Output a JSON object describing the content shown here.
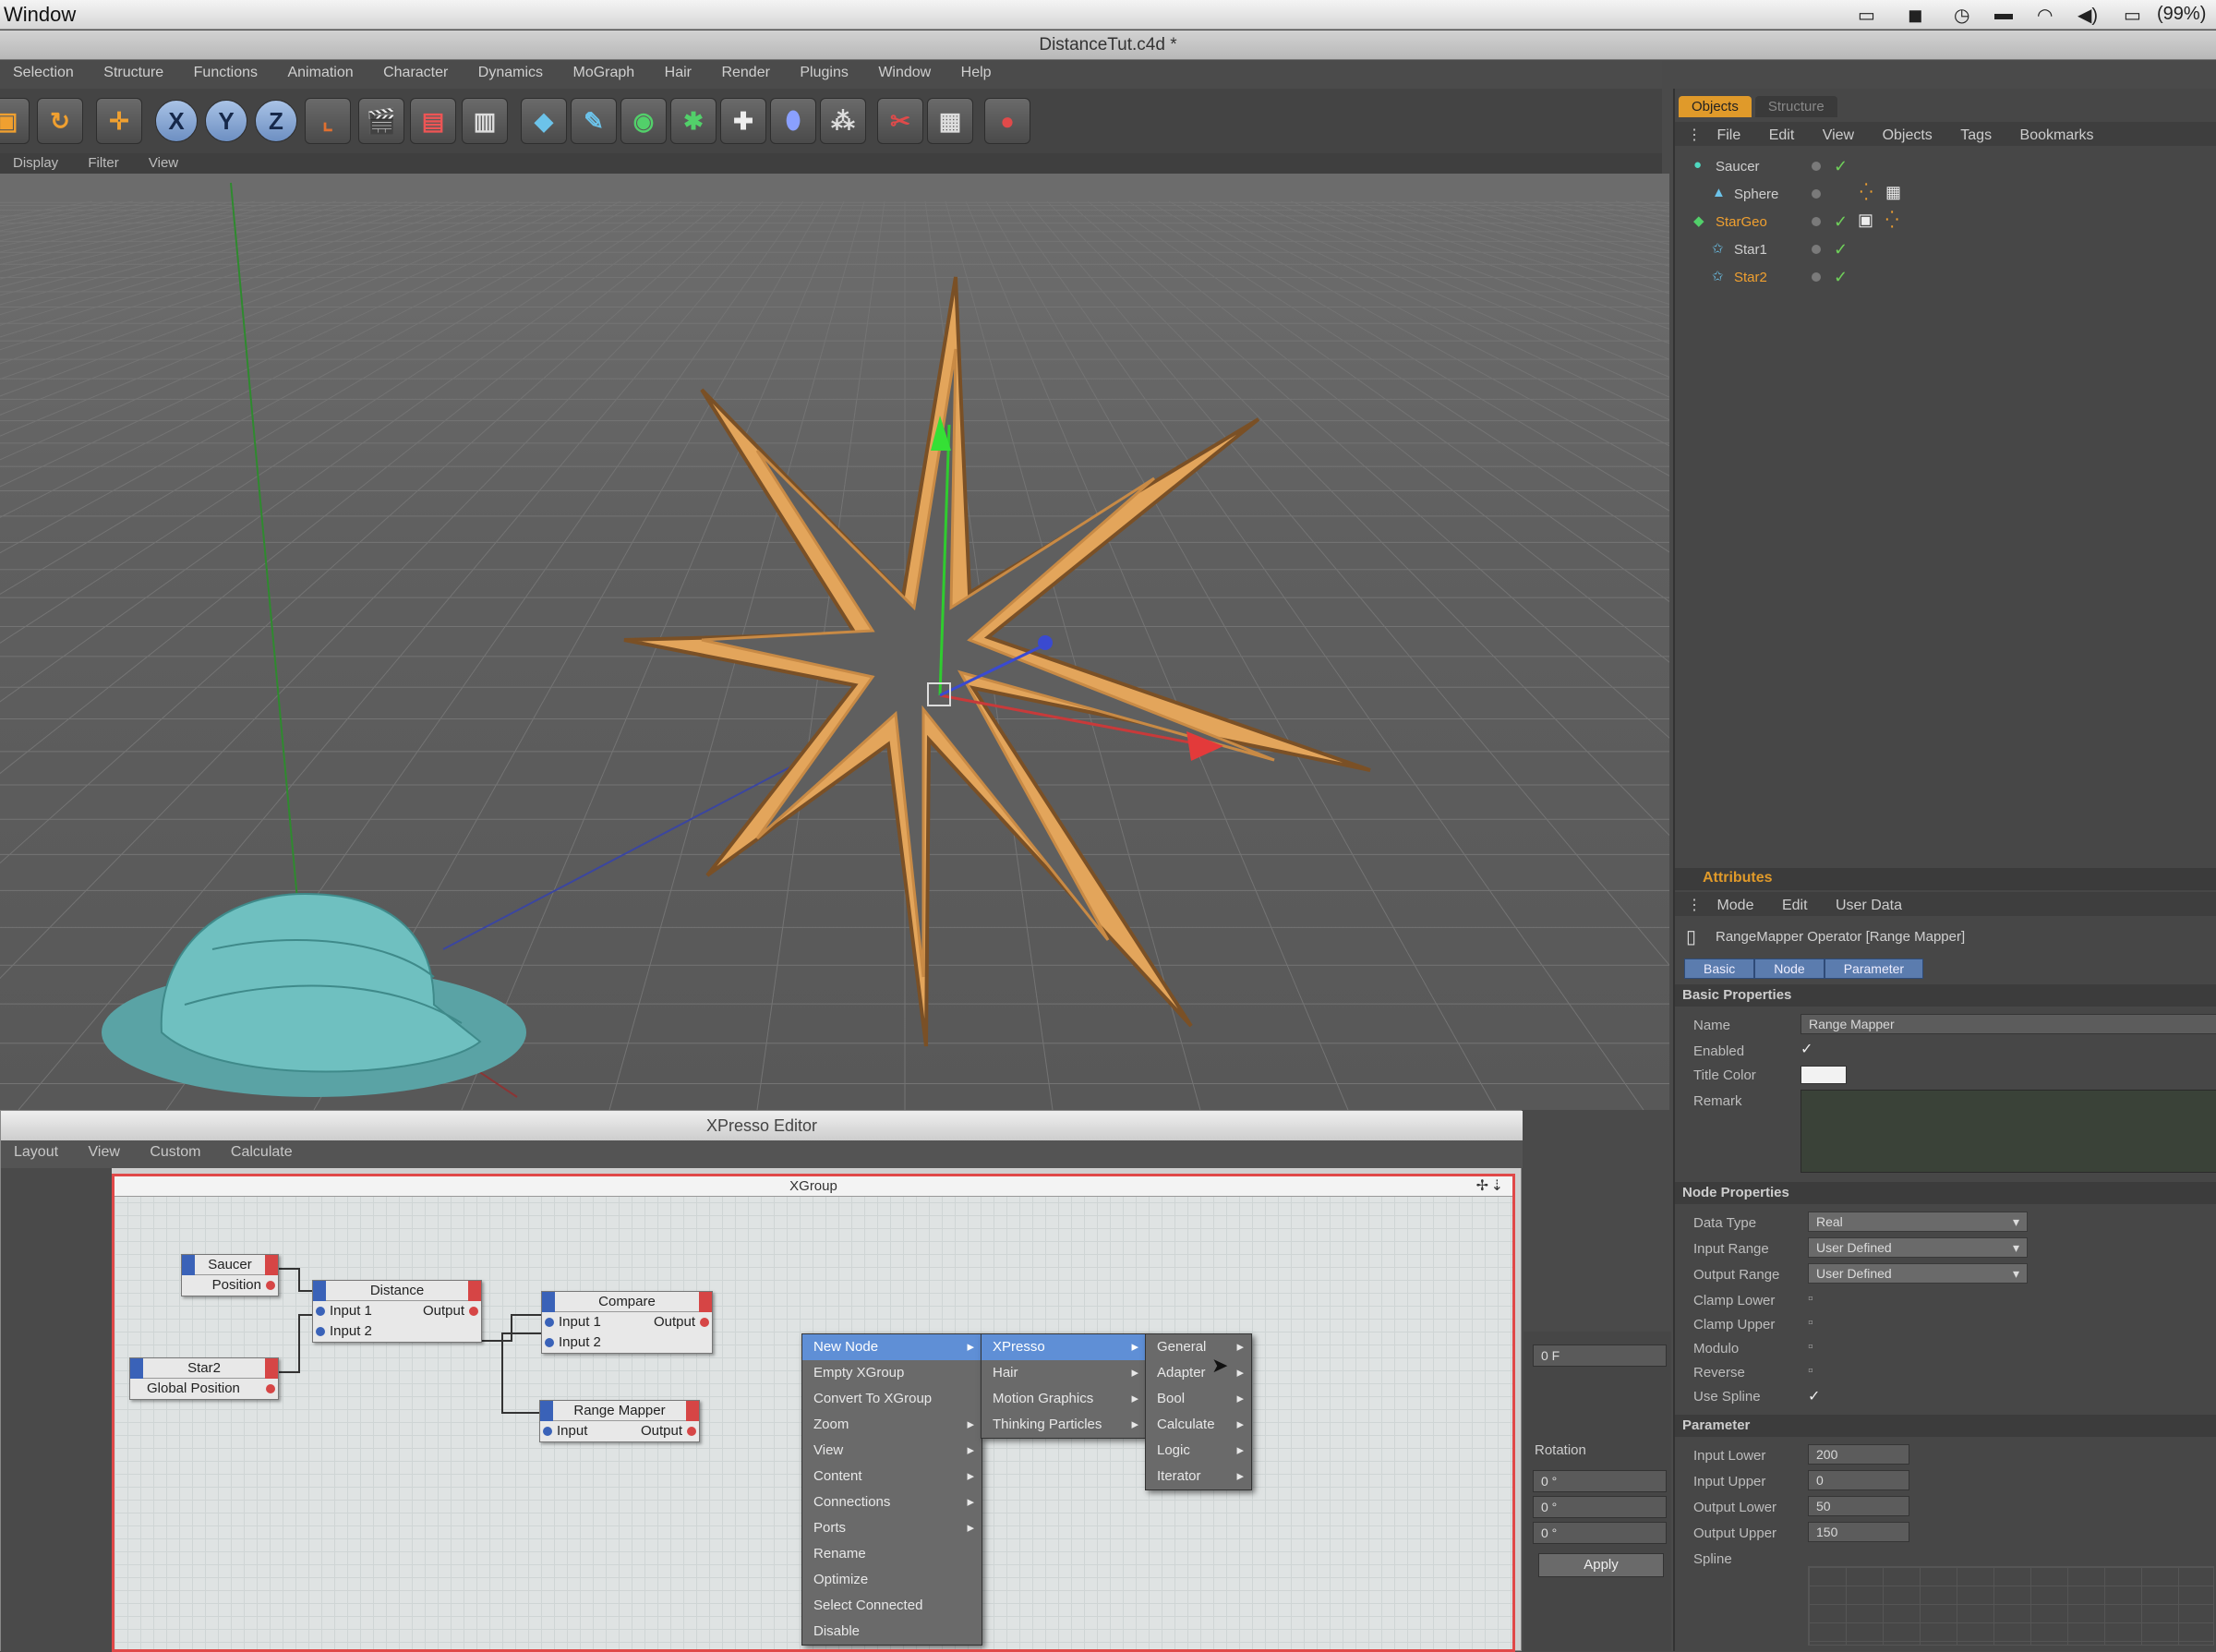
{
  "mac_menubar": {
    "app_menu": "Window",
    "battery": "(99%)"
  },
  "window_title": "DistanceTut.c4d *",
  "main_menu": [
    "Selection",
    "Structure",
    "Functions",
    "Animation",
    "Character",
    "Dynamics",
    "MoGraph",
    "Hair",
    "Render",
    "Plugins",
    "Window",
    "Help"
  ],
  "toolbar": {
    "x_label": "X",
    "y_label": "Y",
    "z_label": "Z"
  },
  "viewport_menu": [
    "Display",
    "Filter",
    "View"
  ],
  "objects_panel": {
    "tabs": [
      "Objects",
      "Structure"
    ],
    "menu": [
      "File",
      "Edit",
      "View",
      "Objects",
      "Tags",
      "Bookmarks"
    ],
    "items": [
      {
        "name": "Saucer"
      },
      {
        "name": "Sphere"
      },
      {
        "name": "StarGeo"
      },
      {
        "name": "Star1"
      },
      {
        "name": "Star2"
      }
    ]
  },
  "attributes": {
    "header": "Attributes",
    "menu": [
      "Mode",
      "Edit",
      "User Data"
    ],
    "operator_title": "RangeMapper Operator [Range Mapper]",
    "tabs": [
      "Basic",
      "Node",
      "Parameter"
    ],
    "basic_section": "Basic Properties",
    "name_label": "Name",
    "name_value": "Range Mapper",
    "enabled_label": "Enabled",
    "title_color_label": "Title Color",
    "remark_label": "Remark",
    "node_section": "Node Properties",
    "data_type_label": "Data Type",
    "data_type_value": "Real",
    "input_range_label": "Input Range",
    "input_range_value": "User Defined",
    "output_range_label": "Output Range",
    "output_range_value": "User Defined",
    "clamp_lower_label": "Clamp Lower",
    "clamp_upper_label": "Clamp Upper",
    "modulo_label": "Modulo",
    "reverse_label": "Reverse",
    "use_spline_label": "Use Spline",
    "parameter_section": "Parameter",
    "input_lower_label": "Input Lower",
    "input_lower_value": "200",
    "input_upper_label": "Input Upper",
    "input_upper_value": "0",
    "output_lower_label": "Output Lower",
    "output_lower_value": "50",
    "output_upper_label": "Output Upper",
    "output_upper_value": "150",
    "spline_label": "Spline"
  },
  "coord_panel": {
    "size_value": "0 F",
    "rotation_label": "Rotation",
    "rot_values": [
      "0 °",
      "0 °",
      "0 °"
    ],
    "apply_label": "Apply"
  },
  "xpresso": {
    "title": "XPresso Editor",
    "menu": [
      "Layout",
      "View",
      "Custom",
      "Calculate"
    ],
    "group_title": "XGroup",
    "nodes": {
      "saucer": {
        "title": "Saucer",
        "port": "Position"
      },
      "star2": {
        "title": "Star2",
        "port": "Global Position"
      },
      "distance": {
        "title": "Distance",
        "in1": "Input 1",
        "in2": "Input 2",
        "out": "Output"
      },
      "compare": {
        "title": "Compare",
        "in1": "Input 1",
        "in2": "Input 2",
        "out": "Output"
      },
      "range_mapper": {
        "title": "Range Mapper",
        "in": "Input",
        "out": "Output"
      }
    },
    "context_menu": {
      "main": [
        "New Node",
        "Empty XGroup",
        "Convert To XGroup",
        "Zoom",
        "View",
        "Content",
        "Connections",
        "Ports",
        "Rename",
        "Optimize",
        "Select Connected",
        "Disable"
      ],
      "sub1": [
        "XPresso",
        "Hair",
        "Motion Graphics",
        "Thinking Particles"
      ],
      "sub2": [
        "General",
        "Adapter",
        "Bool",
        "Calculate",
        "Logic",
        "Iterator"
      ]
    }
  },
  "colors": {
    "accent_orange": "#e09a2a",
    "highlight_blue": "#5f8fd6",
    "star_orange": "#e3a55b",
    "port_in": "#3a62b8",
    "port_out": "#d64545"
  }
}
